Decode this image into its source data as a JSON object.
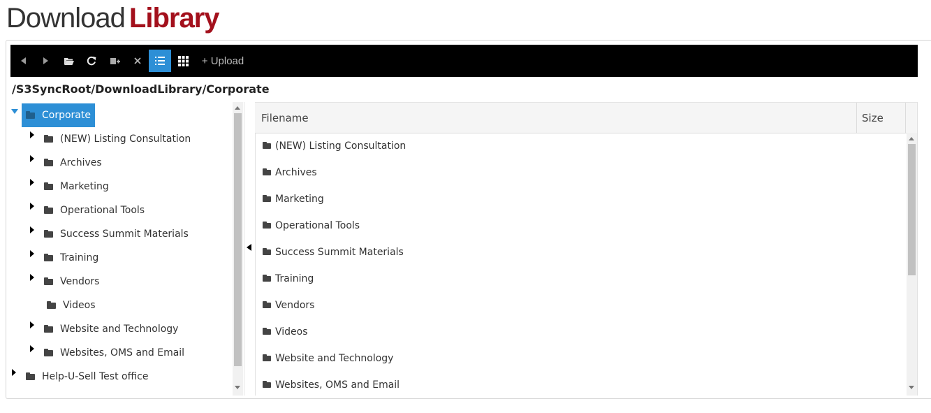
{
  "header": {
    "title_part1": "Download",
    "title_part2": "Library"
  },
  "toolbar": {
    "buttons": [
      {
        "name": "back",
        "icon": "triangle-left-icon"
      },
      {
        "name": "forward",
        "icon": "triangle-right-icon"
      },
      {
        "name": "open-folder",
        "icon": "folder-open-icon"
      },
      {
        "name": "refresh",
        "icon": "refresh-icon"
      },
      {
        "name": "rename",
        "icon": "rename-icon"
      },
      {
        "name": "delete",
        "icon": "close-icon"
      },
      {
        "name": "list-view",
        "icon": "list-icon",
        "active": true
      },
      {
        "name": "grid-view",
        "icon": "grid-icon"
      }
    ],
    "upload_label": "+ Upload"
  },
  "path": "/S3SyncRoot/DownloadLibrary/Corporate",
  "tree": {
    "root": {
      "label": "Corporate",
      "expanded": true,
      "selected": true
    },
    "children": [
      {
        "label": "(NEW) Listing Consultation",
        "has_children": true
      },
      {
        "label": "Archives",
        "has_children": true
      },
      {
        "label": "Marketing",
        "has_children": true
      },
      {
        "label": "Operational Tools",
        "has_children": true
      },
      {
        "label": "Success Summit Materials",
        "has_children": true
      },
      {
        "label": "Training",
        "has_children": true
      },
      {
        "label": "Vendors",
        "has_children": true
      },
      {
        "label": "Videos",
        "has_children": false
      },
      {
        "label": "Website and Technology",
        "has_children": true
      },
      {
        "label": "Websites, OMS and Email",
        "has_children": true
      }
    ],
    "sibling": {
      "label": "Help-U-Sell Test office",
      "has_children": true
    }
  },
  "grid": {
    "columns": [
      "Filename",
      "Size"
    ],
    "rows": [
      {
        "name": "(NEW) Listing Consultation",
        "size": ""
      },
      {
        "name": "Archives",
        "size": ""
      },
      {
        "name": "Marketing",
        "size": ""
      },
      {
        "name": "Operational Tools",
        "size": ""
      },
      {
        "name": "Success Summit Materials",
        "size": ""
      },
      {
        "name": "Training",
        "size": ""
      },
      {
        "name": "Vendors",
        "size": ""
      },
      {
        "name": "Videos",
        "size": ""
      },
      {
        "name": "Website and Technology",
        "size": ""
      },
      {
        "name": "Websites, OMS and Email",
        "size": ""
      }
    ]
  },
  "colors": {
    "accent": "#2d8fd6",
    "brand_red": "#a3101c",
    "toolbar_bg": "#000000"
  }
}
